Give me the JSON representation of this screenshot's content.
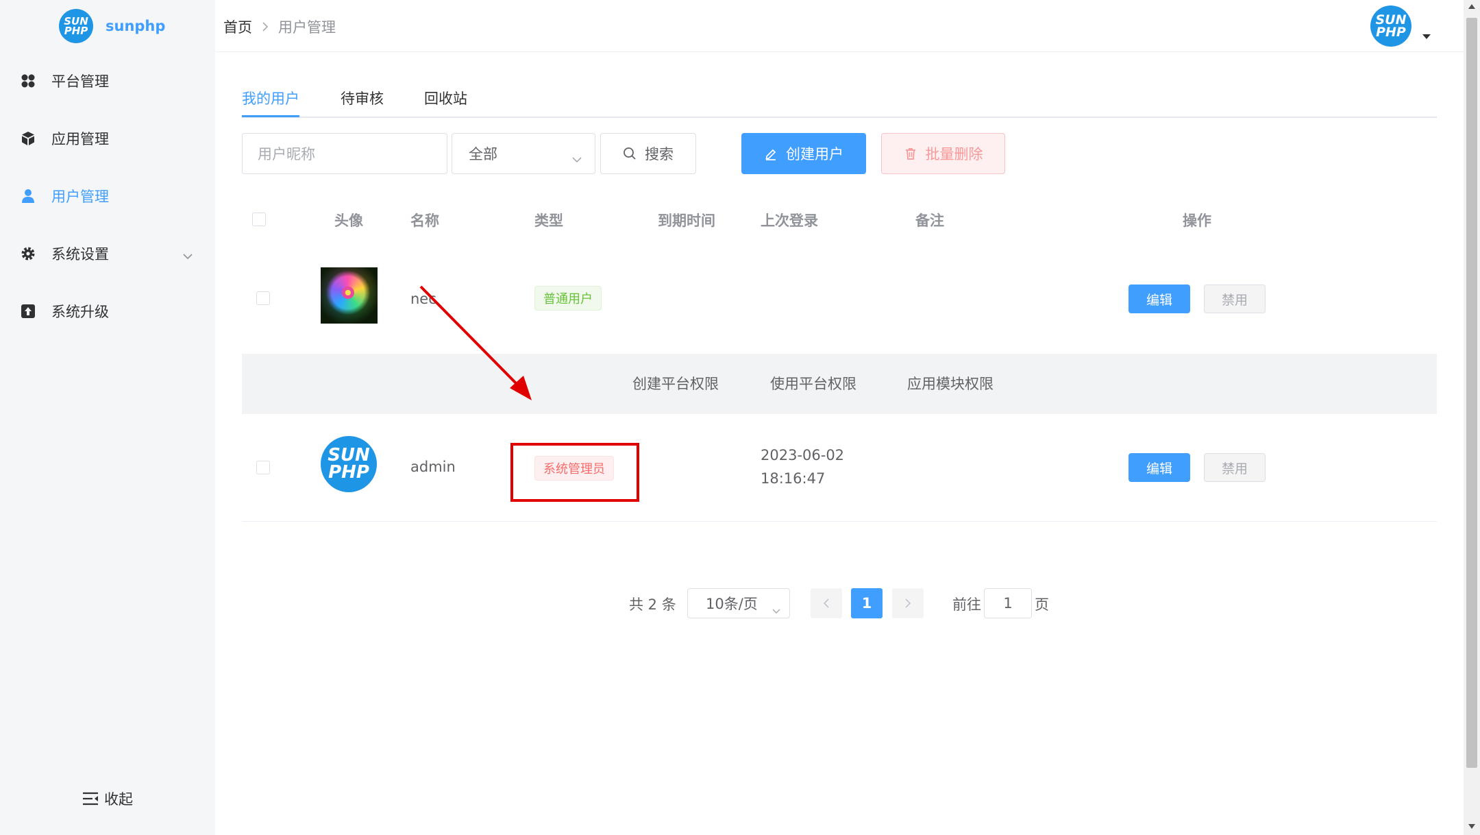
{
  "brand": {
    "logo_line1": "SUN",
    "logo_line2": "PHP",
    "name": "sunphp"
  },
  "sidebar": {
    "items": [
      {
        "label": "平台管理",
        "icon": "grid-icon"
      },
      {
        "label": "应用管理",
        "icon": "cube-icon"
      },
      {
        "label": "用户管理",
        "icon": "user-icon",
        "active": true
      },
      {
        "label": "系统设置",
        "icon": "gear-icon",
        "has_submenu": true
      },
      {
        "label": "系统升级",
        "icon": "upload-icon"
      }
    ],
    "collapse_label": "收起"
  },
  "breadcrumb": {
    "home": "首页",
    "current": "用户管理"
  },
  "header": {
    "avatar_line1": "SUN",
    "avatar_line2": "PHP"
  },
  "tabs": [
    {
      "label": "我的用户",
      "active": true
    },
    {
      "label": "待审核"
    },
    {
      "label": "回收站"
    }
  ],
  "filters": {
    "nickname_placeholder": "用户昵称",
    "type_select": "全部",
    "search_label": "搜索",
    "create_label": "创建用户",
    "batch_delete_label": "批量删除"
  },
  "table": {
    "columns": [
      "头像",
      "名称",
      "类型",
      "到期时间",
      "上次登录",
      "备注",
      "操作"
    ],
    "rows": [
      {
        "name": "nec",
        "type": "普通用户",
        "expire": "",
        "last_login_date": "",
        "last_login_time": "",
        "remark": "",
        "edit": "编辑",
        "disable": "禁用"
      },
      {
        "name": "admin",
        "type": "系统管理员",
        "expire": "",
        "last_login_date": "2023-06-02",
        "last_login_time": "18:16:47",
        "remark": "",
        "edit": "编辑",
        "disable": "禁用"
      }
    ],
    "expand_permissions": [
      "创建平台权限",
      "使用平台权限",
      "应用模块权限"
    ]
  },
  "pagination": {
    "total": "共 2 条",
    "page_size": "10条/页",
    "current_page": "1",
    "goto_label": "前往",
    "goto_value": "1",
    "page_suffix": "页"
  },
  "colors": {
    "primary": "#409eff",
    "danger": "#f56c6c",
    "success": "#67c23a",
    "annotation": "#e00000"
  }
}
